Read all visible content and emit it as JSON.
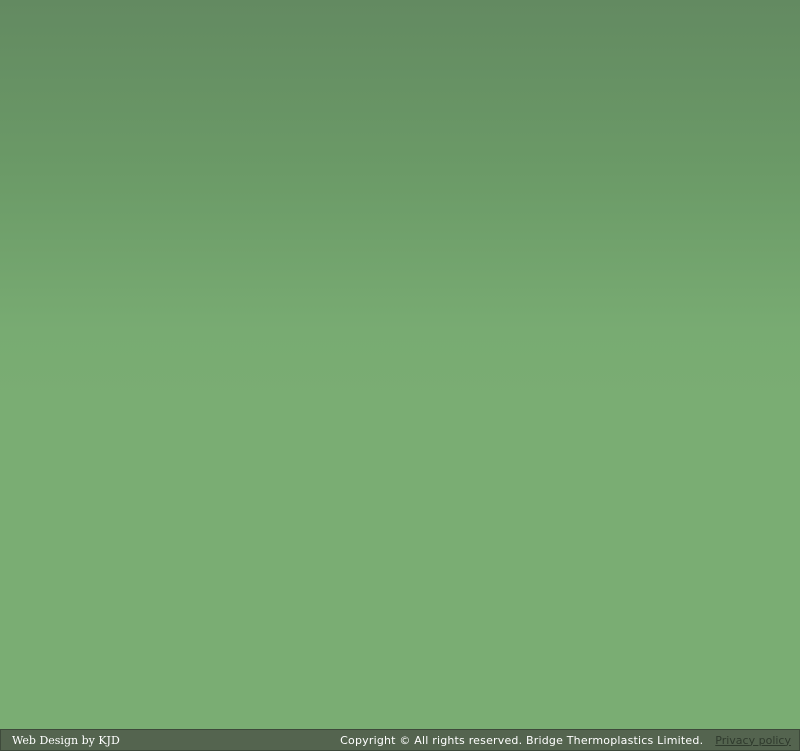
{
  "colors": {
    "background_top": "#638a61",
    "background_bottom": "#7aad73",
    "footer_bg": "#54644f",
    "footer_text": "#ffffff",
    "privacy_link": "#2f3a2d"
  },
  "footer": {
    "credit": "Web Design by KJD",
    "copyright": "Copyright © All rights reserved. Bridge Thermoplastics Limited.",
    "privacy_link": "Privacy policy"
  }
}
